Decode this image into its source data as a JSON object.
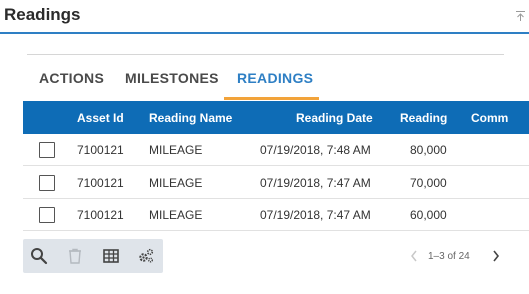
{
  "header": {
    "title": "Readings"
  },
  "tabs": [
    {
      "label": "ACTIONS"
    },
    {
      "label": "MILESTONES"
    },
    {
      "label": "READINGS"
    }
  ],
  "table": {
    "columns": [
      "Asset Id",
      "Reading Name",
      "Reading Date",
      "Reading",
      "Comm"
    ],
    "rows": [
      {
        "asset_id": "7100121",
        "reading_name": "MILEAGE",
        "reading_date": "07/19/2018, 7:48 AM",
        "reading": "80,000"
      },
      {
        "asset_id": "7100121",
        "reading_name": "MILEAGE",
        "reading_date": "07/19/2018, 7:47 AM",
        "reading": "70,000"
      },
      {
        "asset_id": "7100121",
        "reading_name": "MILEAGE",
        "reading_date": "07/19/2018, 7:47 AM",
        "reading": "60,000"
      }
    ]
  },
  "toolbar": {
    "icons": [
      "search-icon",
      "delete-icon",
      "table-icon",
      "settings-icon"
    ]
  },
  "pager": {
    "text": "1–3 of 24"
  },
  "colors": {
    "accent": "#2e7fc4",
    "header_bg": "#0e6cb6",
    "tab_underline": "#f2a33a",
    "toolbar_bg": "#dfe4ea"
  }
}
